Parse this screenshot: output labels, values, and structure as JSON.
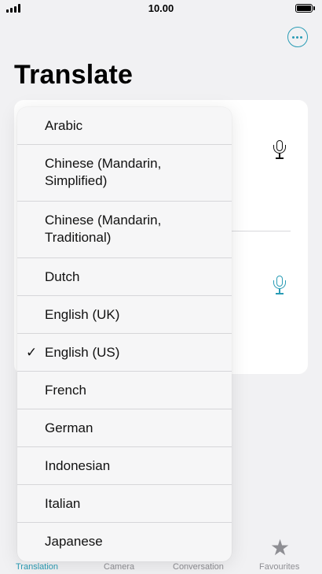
{
  "status_bar": {
    "time": "10.00"
  },
  "header": {
    "title": "Translate"
  },
  "icons": {
    "more": "more-options-icon",
    "mic": "microphone-icon",
    "check": "checkmark-icon",
    "star": "star-icon"
  },
  "colors": {
    "accent": "#2a9cb5",
    "background": "#f1f1f3",
    "card": "#ffffff",
    "menu": "#f6f6f7"
  },
  "language_menu": {
    "items": [
      {
        "label": "Arabic",
        "selected": false
      },
      {
        "label": "Chinese (Mandarin,\nSimplified)",
        "selected": false
      },
      {
        "label": "Chinese (Mandarin,\nTraditional)",
        "selected": false
      },
      {
        "label": "Dutch",
        "selected": false
      },
      {
        "label": "English (UK)",
        "selected": false
      },
      {
        "label": "English (US)",
        "selected": true
      },
      {
        "label": "French",
        "selected": false
      },
      {
        "label": "German",
        "selected": false
      },
      {
        "label": "Indonesian",
        "selected": false
      },
      {
        "label": "Italian",
        "selected": false
      },
      {
        "label": "Japanese",
        "selected": false
      }
    ],
    "check_glyph": "✓"
  },
  "tab_bar": {
    "tabs": [
      {
        "label": "Translation",
        "active": true
      },
      {
        "label": "Camera",
        "active": false
      },
      {
        "label": "Conversation",
        "active": false
      },
      {
        "label": "Favourites",
        "active": false
      }
    ]
  }
}
